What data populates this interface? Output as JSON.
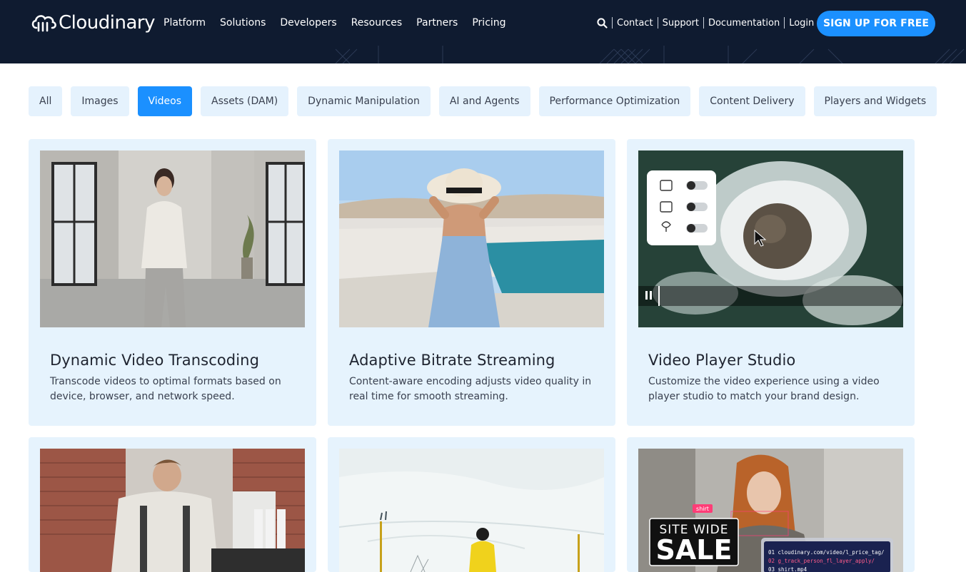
{
  "header": {
    "brand": "Cloudinary",
    "nav": [
      "Platform",
      "Solutions",
      "Developers",
      "Resources",
      "Partners",
      "Pricing"
    ],
    "links": [
      "Contact",
      "Support",
      "Documentation",
      "Login"
    ],
    "signup_label": "SIGN UP FOR FREE"
  },
  "filters": {
    "items": [
      "All",
      "Images",
      "Videos",
      "Assets (DAM)",
      "Dynamic Manipulation",
      "AI and Agents",
      "Performance Optimization",
      "Content Delivery",
      "Players and Widgets"
    ],
    "active": "Videos"
  },
  "cards": [
    {
      "title": "Dynamic Video Transcoding",
      "desc": "Transcode videos to optimal formats based on device, browser, and network speed."
    },
    {
      "title": "Adaptive Bitrate Streaming",
      "desc": "Content-aware encoding adjusts video quality in real time for smooth streaming."
    },
    {
      "title": "Video Player Studio",
      "desc": "Customize the video experience using a video player studio to match your brand design."
    },
    {
      "title": "",
      "desc": ""
    },
    {
      "title": "",
      "desc": ""
    },
    {
      "title": "",
      "desc": ""
    }
  ],
  "overlays": {
    "shirt_tag": "shirt",
    "sale_line1": "SITE WIDE",
    "sale_line2": "SALE",
    "code_lines": [
      "01  cloudinary.com/video/l_price_tag/",
      "02  g_track_person_fl_layer_apply/",
      "03  shirt.mp4"
    ]
  },
  "colors": {
    "header_bg": "#0f1b30",
    "accent": "#1b90ff",
    "chip_bg": "#e5f2fd",
    "card_bg": "#e6f3fd"
  }
}
